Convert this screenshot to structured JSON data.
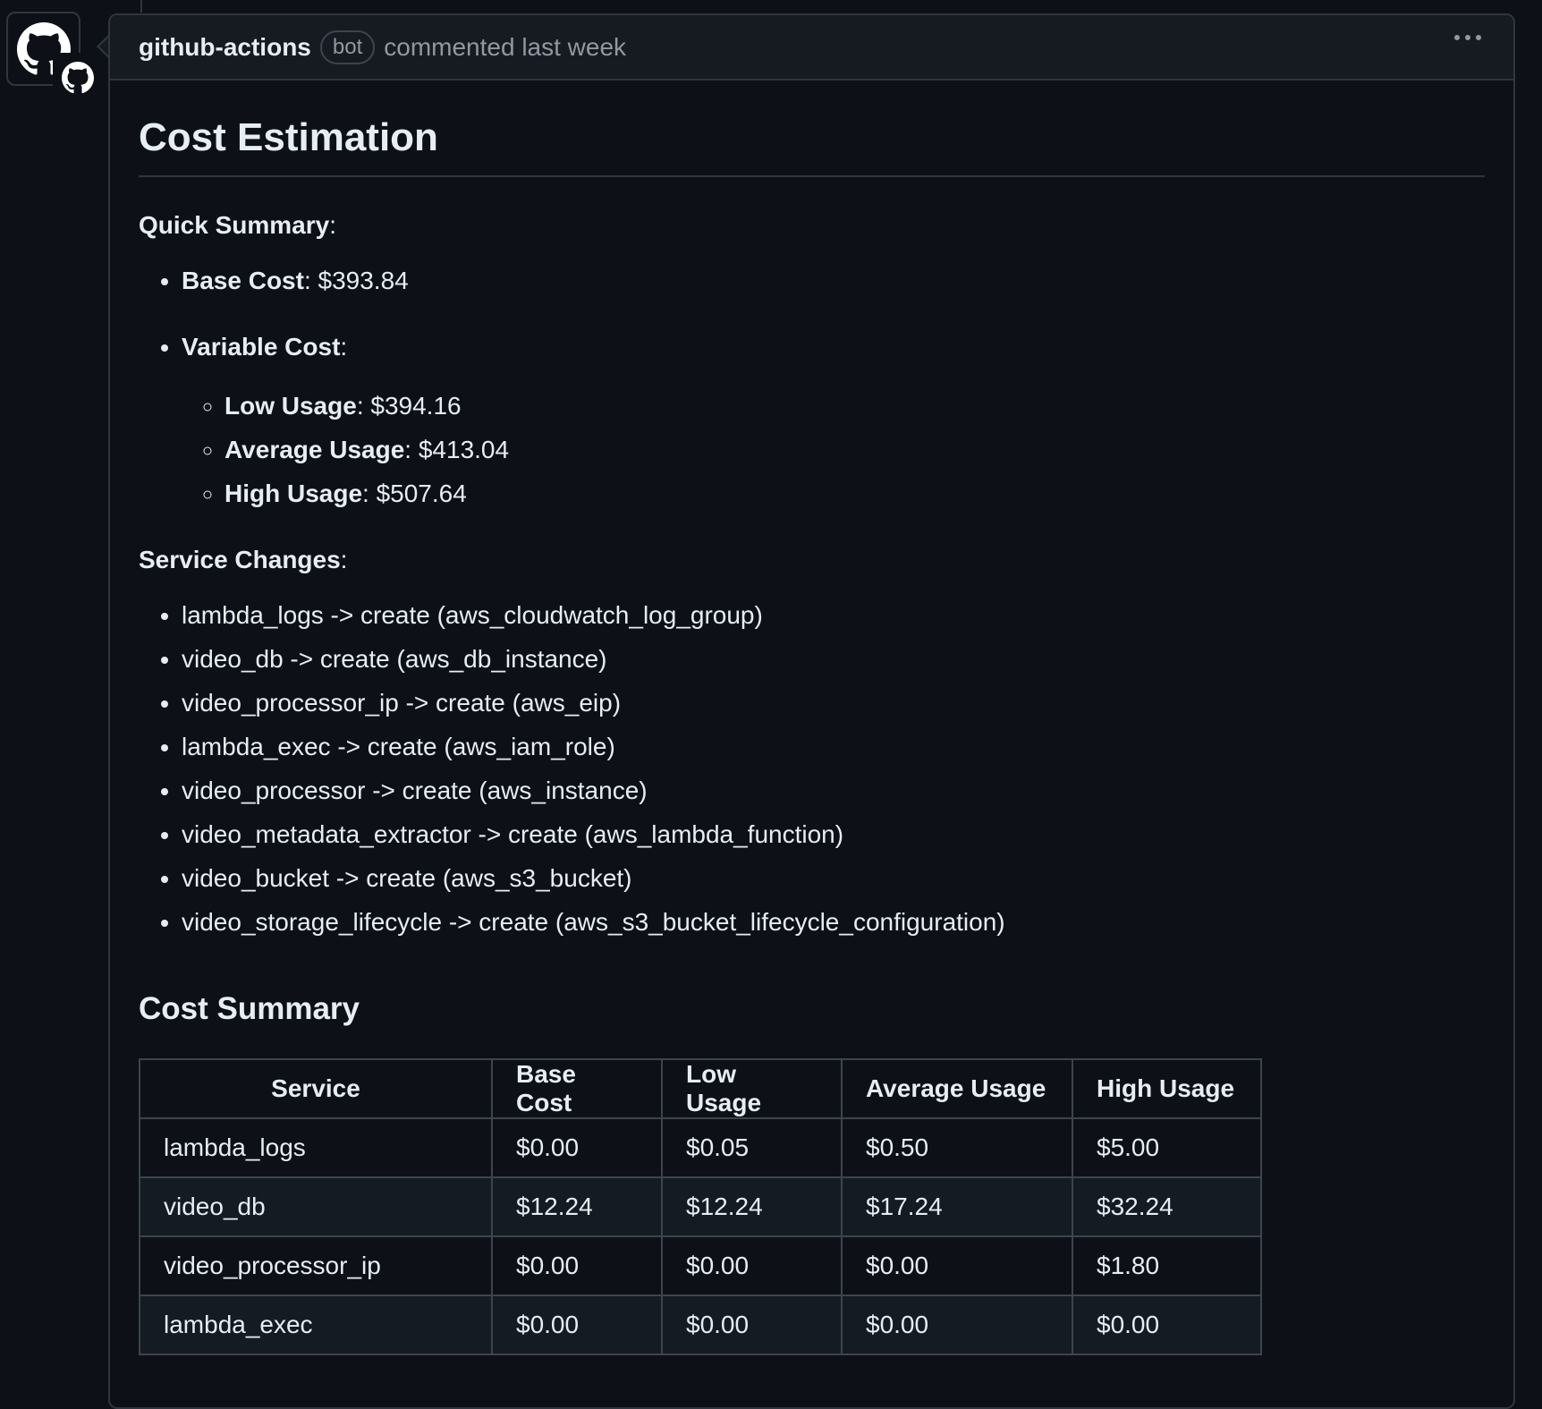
{
  "comment": {
    "author": "github-actions",
    "badge": "bot",
    "meta": "commented last week"
  },
  "body": {
    "title": "Cost Estimation",
    "quick_summary_label": "Quick Summary",
    "base_cost": {
      "label": "Base Cost",
      "value": "$393.84"
    },
    "variable_cost_label": "Variable Cost",
    "variable": [
      {
        "label": "Low Usage",
        "value": "$394.16"
      },
      {
        "label": "Average Usage",
        "value": "$413.04"
      },
      {
        "label": "High Usage",
        "value": "$507.64"
      }
    ],
    "service_changes_label": "Service Changes",
    "service_changes": [
      "lambda_logs -> create (aws_cloudwatch_log_group)",
      "video_db -> create (aws_db_instance)",
      "video_processor_ip -> create (aws_eip)",
      "lambda_exec -> create (aws_iam_role)",
      "video_processor -> create (aws_instance)",
      "video_metadata_extractor -> create (aws_lambda_function)",
      "video_bucket -> create (aws_s3_bucket)",
      "video_storage_lifecycle -> create (aws_s3_bucket_lifecycle_configuration)"
    ],
    "cost_summary_title": "Cost Summary",
    "table": {
      "headers": [
        "Service",
        "Base Cost",
        "Low Usage",
        "Average Usage",
        "High Usage"
      ],
      "rows": [
        [
          "lambda_logs",
          "$0.00",
          "$0.05",
          "$0.50",
          "$5.00"
        ],
        [
          "video_db",
          "$12.24",
          "$12.24",
          "$17.24",
          "$32.24"
        ],
        [
          "video_processor_ip",
          "$0.00",
          "$0.00",
          "$0.00",
          "$1.80"
        ],
        [
          "lambda_exec",
          "$0.00",
          "$0.00",
          "$0.00",
          "$0.00"
        ]
      ]
    }
  },
  "icons": {
    "avatar": "github-octocat-icon",
    "badge": "github-app-icon",
    "more": "kebab-horizontal-icon"
  }
}
